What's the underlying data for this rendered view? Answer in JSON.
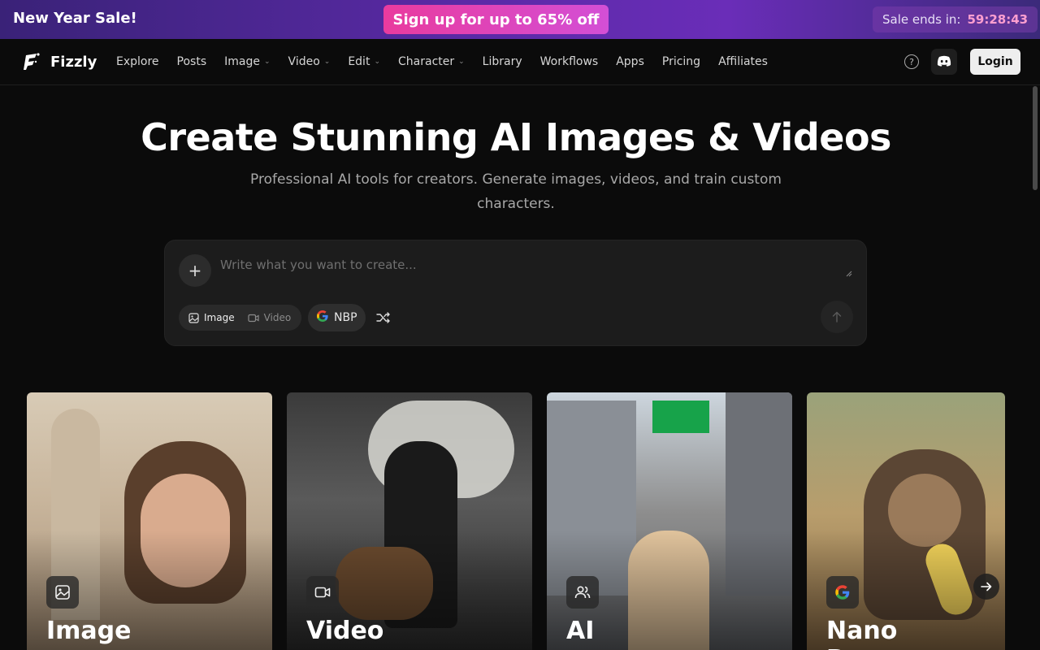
{
  "banner": {
    "title": "New Year Sale!",
    "cta": "Sign up for up to 65% off",
    "timer_label": "Sale ends in:",
    "timer_value": "59:28:43"
  },
  "nav": {
    "brand": "Fizzly",
    "links": [
      {
        "label": "Explore",
        "dropdown": false
      },
      {
        "label": "Posts",
        "dropdown": false
      },
      {
        "label": "Image",
        "dropdown": true
      },
      {
        "label": "Video",
        "dropdown": true
      },
      {
        "label": "Edit",
        "dropdown": true
      },
      {
        "label": "Character",
        "dropdown": true
      },
      {
        "label": "Library",
        "dropdown": false
      },
      {
        "label": "Workflows",
        "dropdown": false
      },
      {
        "label": "Apps",
        "dropdown": false
      },
      {
        "label": "Pricing",
        "dropdown": false
      },
      {
        "label": "Affiliates",
        "dropdown": false
      }
    ],
    "help_icon": "?",
    "login": "Login"
  },
  "hero": {
    "title": "Create Stunning AI Images & Videos",
    "subtitle": "Professional AI tools for creators. Generate images, videos, and train custom characters."
  },
  "prompt": {
    "placeholder": "Write what you want to create...",
    "value": "",
    "modes": [
      {
        "label": "Image",
        "active": true
      },
      {
        "label": "Video",
        "active": false
      }
    ],
    "model": "NBP"
  },
  "cards": [
    {
      "label": "Image",
      "icon": "image-icon"
    },
    {
      "label": "Video",
      "icon": "video-icon"
    },
    {
      "label": "AI",
      "icon": "users-icon"
    },
    {
      "label": "Nano Banana",
      "icon": "google-icon"
    }
  ],
  "colors": {
    "background": "#0b0b0b",
    "banner_start": "#3a2278",
    "banner_cta": "#e93b9e",
    "timer_accent": "#ff9fd0",
    "login_bg": "#eeeeee"
  }
}
